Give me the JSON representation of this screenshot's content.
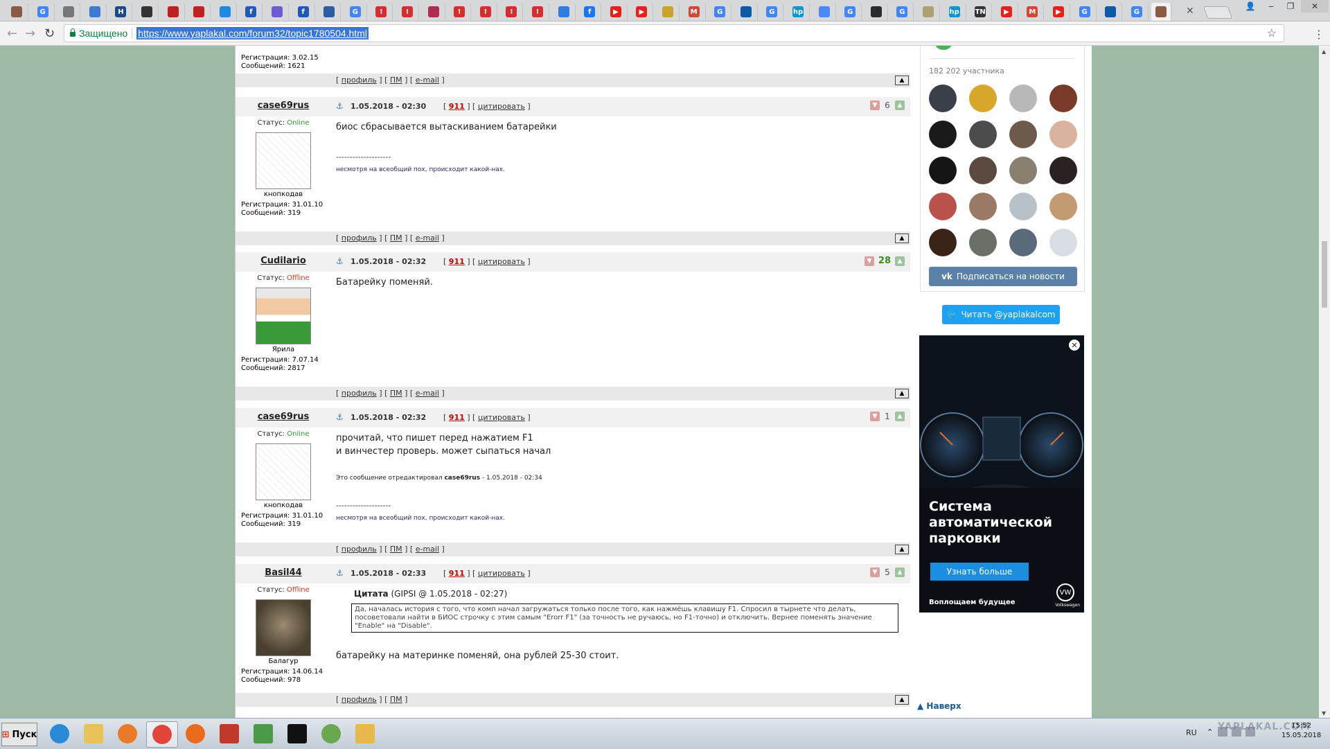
{
  "browser": {
    "secure_label": "Защищено",
    "url": "https://www.yaplakal.com/forum32/topic1780504.html",
    "tabs": [
      {
        "icon": "site-icon",
        "color": "#8a5a44",
        "glyph": ""
      },
      {
        "icon": "google-icon",
        "color": "#4285f4",
        "glyph": "G"
      },
      {
        "icon": "page-icon",
        "color": "#777777",
        "glyph": ""
      },
      {
        "icon": "diamond-icon",
        "color": "#3a7bd5",
        "glyph": ""
      },
      {
        "icon": "h-icon",
        "color": "#1b4a8a",
        "glyph": "H"
      },
      {
        "icon": "save-icon",
        "color": "#333333",
        "glyph": ""
      },
      {
        "icon": "figure-icon",
        "color": "#c02020",
        "glyph": ""
      },
      {
        "icon": "figure-icon",
        "color": "#c02020",
        "glyph": ""
      },
      {
        "icon": "refresh-icon",
        "color": "#1e88e5",
        "glyph": ""
      },
      {
        "icon": "f-icon",
        "color": "#1e5ab5",
        "glyph": "f"
      },
      {
        "icon": "stripe-icon",
        "color": "#6b5bd6",
        "glyph": ""
      },
      {
        "icon": "f-icon",
        "color": "#1e5ab5",
        "glyph": "f"
      },
      {
        "icon": "tool-icon",
        "color": "#2a5ca8",
        "glyph": ""
      },
      {
        "icon": "google-icon",
        "color": "#4285f4",
        "glyph": "G"
      },
      {
        "icon": "pin-icon",
        "color": "#d32f2f",
        "glyph": "!"
      },
      {
        "icon": "pin-icon",
        "color": "#d32f2f",
        "glyph": "!"
      },
      {
        "icon": "pin-icon",
        "color": "#b02c50",
        "glyph": ""
      },
      {
        "icon": "pin-icon",
        "color": "#d32f2f",
        "glyph": "!"
      },
      {
        "icon": "pin-icon",
        "color": "#d32f2f",
        "glyph": "!"
      },
      {
        "icon": "pin-icon",
        "color": "#d32f2f",
        "glyph": "!"
      },
      {
        "icon": "pin-icon",
        "color": "#d32f2f",
        "glyph": "!"
      },
      {
        "icon": "chat-icon",
        "color": "#2f7de1",
        "glyph": ""
      },
      {
        "icon": "facebook-icon",
        "color": "#1877f2",
        "glyph": "f"
      },
      {
        "icon": "youtube-icon",
        "color": "#e62117",
        "glyph": "▶"
      },
      {
        "icon": "youtube-icon",
        "color": "#e62117",
        "glyph": "▶"
      },
      {
        "icon": "emblem-icon",
        "color": "#c9a227",
        "glyph": ""
      },
      {
        "icon": "gmail-icon",
        "color": "#d14836",
        "glyph": "M"
      },
      {
        "icon": "google-icon",
        "color": "#4285f4",
        "glyph": "G"
      },
      {
        "icon": "mail-icon",
        "color": "#0a5aa8",
        "glyph": ""
      },
      {
        "icon": "google-icon",
        "color": "#4285f4",
        "glyph": "G"
      },
      {
        "icon": "hp-icon",
        "color": "#0096d6",
        "glyph": "hp"
      },
      {
        "icon": "translate-icon",
        "color": "#4a8af4",
        "glyph": ""
      },
      {
        "icon": "google-icon",
        "color": "#4285f4",
        "glyph": "G"
      },
      {
        "icon": "avatar-icon",
        "color": "#2b2b2b",
        "glyph": ""
      },
      {
        "icon": "google-icon",
        "color": "#4285f4",
        "glyph": "G"
      },
      {
        "icon": "doc-icon",
        "color": "#b0a070",
        "glyph": ""
      },
      {
        "icon": "hp-icon",
        "color": "#0096d6",
        "glyph": "hp"
      },
      {
        "icon": "tn-icon",
        "color": "#333333",
        "glyph": "TN"
      },
      {
        "icon": "youtube-icon",
        "color": "#e62117",
        "glyph": "▶"
      },
      {
        "icon": "gmail-icon",
        "color": "#d14836",
        "glyph": "M"
      },
      {
        "icon": "youtube-icon",
        "color": "#e62117",
        "glyph": "▶"
      },
      {
        "icon": "google-icon",
        "color": "#4285f4",
        "glyph": "G"
      },
      {
        "icon": "mail-icon",
        "color": "#0a5aa8",
        "glyph": ""
      },
      {
        "icon": "google-icon",
        "color": "#4285f4",
        "glyph": "G"
      },
      {
        "icon": "site-icon",
        "color": "#8a5a44",
        "glyph": ""
      }
    ]
  },
  "forum": {
    "bar_links": {
      "profile": "профиль",
      "pm": "ПМ",
      "email": "e-mail"
    },
    "top_partial": {
      "reg": "Регистрация: 3.02.15",
      "msgs": "Сообщений: 1621"
    },
    "posts": [
      {
        "author": "case69rus",
        "status_label": "Статус:",
        "status": "Online",
        "status_kind": "on",
        "rank": "кнопкодав",
        "reg": "Регистрация: 31.01.10",
        "msgs": "Сообщений: 319",
        "datetime": "1.05.2018 - 02:30",
        "num": "911",
        "quote_label": "цитировать",
        "score": "6",
        "score_big": false,
        "lines": [
          "биос сбрасывается вытаскиванием батарейки"
        ],
        "edited": "",
        "sig_sep": "--------------------",
        "sig": "несмотря на всеобщий пох, происходит какой-нах.",
        "has_email": true
      },
      {
        "author": "Cudilario",
        "status_label": "Статус:",
        "status": "Offline",
        "status_kind": "off",
        "rank": "Ярила",
        "reg": "Регистрация: 7.07.14",
        "msgs": "Сообщений: 2817",
        "datetime": "1.05.2018 - 02:32",
        "num": "911",
        "quote_label": "цитировать",
        "score": "28",
        "score_big": true,
        "lines": [
          "Батарейку поменяй."
        ],
        "edited": "",
        "sig_sep": "",
        "sig": "",
        "has_email": true
      },
      {
        "author": "case69rus",
        "status_label": "Статус:",
        "status": "Online",
        "status_kind": "on",
        "rank": "кнопкодав",
        "reg": "Регистрация: 31.01.10",
        "msgs": "Сообщений: 319",
        "datetime": "1.05.2018 - 02:32",
        "num": "911",
        "quote_label": "цитировать",
        "score": "1",
        "score_big": false,
        "lines": [
          "прочитай, что пишет перед нажатием F1",
          "и винчестер проверь. может сыпаться начал"
        ],
        "edited_prefix": "Это сообщение отредактировал ",
        "edited_user": "case69rus",
        "edited_suffix": " - 1.05.2018 - 02:34",
        "sig_sep": "--------------------",
        "sig": "несмотря на всеобщий пох, происходит какой-нах.",
        "has_email": true
      },
      {
        "author": "Basil44",
        "status_label": "Статус:",
        "status": "Offline",
        "status_kind": "off",
        "rank": "Балагур",
        "reg": "Регистрация: 14.06.14",
        "msgs": "Сообщений: 978",
        "datetime": "1.05.2018 - 02:33",
        "num": "911",
        "quote_label": "цитировать",
        "score": "5",
        "score_big": false,
        "quote_word": "Цитата",
        "quote_src": " (GIPSI @ 1.05.2018 - 02:27)",
        "quote_text": "Да, началась история с того, что комп начал загружаться только после того, как нажмёшь клавишу F1. Спросил в тырнете что делать, посоветовали найти в БИОС строчку с этим самым \"Erorr F1\" (за точность не ручаюсь, но F1-точно) и отключить. Вернее поменять значение \"Enable\" на \"Disable\".",
        "lines": [
          "батарейку на материнке поменяй, она рублей 25-30 стоит."
        ],
        "edited": "",
        "sig_sep": "",
        "sig": "",
        "has_email": false
      }
    ]
  },
  "sidebar": {
    "members": "182 202 участника",
    "vk_subscribe": "Подписаться на новости",
    "twitter": "Читать @yaplakalcom",
    "avatars": [
      "#3a3f48",
      "#d8a62a",
      "#b8b8b8",
      "#7a3a2a",
      "#1a1a1a",
      "#4c4c4c",
      "#6e5a4a",
      "#d9b3a0",
      "#151515",
      "#5a4a40",
      "#8a8070",
      "#2a2220",
      "#b9524a",
      "#9a7a66",
      "#b8c0c8",
      "#c49a72",
      "#3a2418",
      "#6a7068",
      "#5a6a7a",
      "#d8dde3"
    ],
    "ad": {
      "title": "Система автоматической парковки",
      "button": "Узнать больше",
      "footer": "Воплощаем будущее",
      "brand": "Volkswagen"
    },
    "to_top": "Наверх"
  },
  "taskbar": {
    "start": "Пуск",
    "apps": [
      {
        "icon": "ie-icon",
        "color": "#2a8ad8"
      },
      {
        "icon": "explorer-icon",
        "color": "#e8c35a"
      },
      {
        "icon": "media-player-icon",
        "color": "#e87a2a"
      },
      {
        "icon": "chrome-icon",
        "color": "#e0443a",
        "active": true
      },
      {
        "icon": "firefox-icon",
        "color": "#e86a1a"
      },
      {
        "icon": "toolbox-icon",
        "color": "#c0392b"
      },
      {
        "icon": "network-icon",
        "color": "#4a9a4a"
      },
      {
        "icon": "cmd-icon",
        "color": "#111111"
      },
      {
        "icon": "recycle-icon",
        "color": "#6aa84f"
      },
      {
        "icon": "folder-icon",
        "color": "#e8b84a"
      }
    ],
    "lang": "RU",
    "time": "15:52",
    "date": "15.05.2018",
    "watermark": "YAPLAKAL.COM"
  }
}
